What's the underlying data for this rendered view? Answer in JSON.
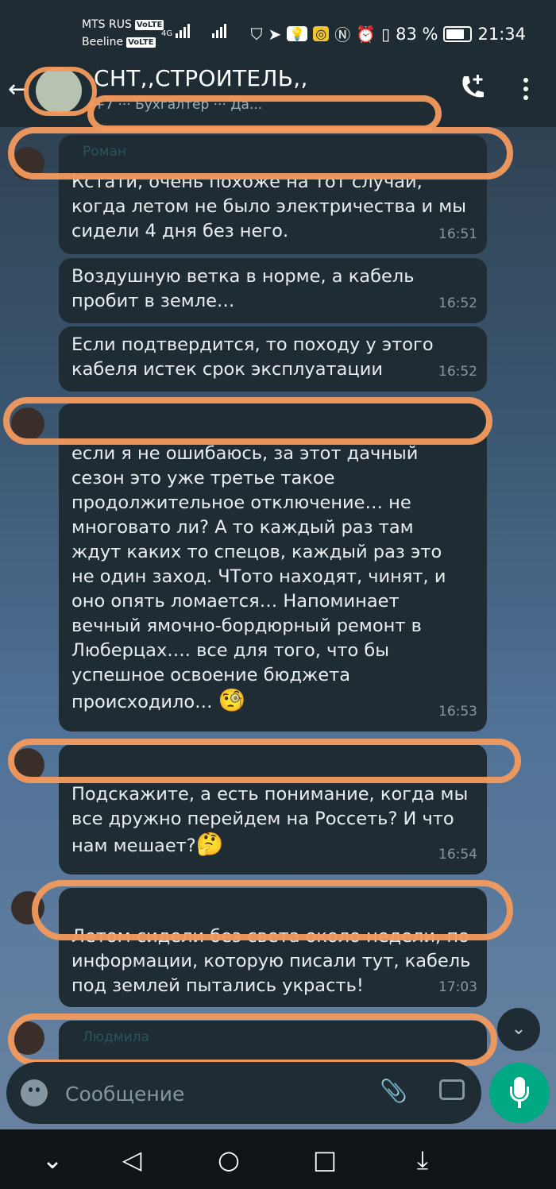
{
  "status_bar": {
    "carrier1": "MTS RUS",
    "carrier2": "Beeline",
    "volte": "VoLTE",
    "network": "4G",
    "battery": "83 %",
    "time": "21:34",
    "icons": [
      "signal-icon",
      "shield-icon",
      "telegram-icon",
      "bulb-icon",
      "target-icon",
      "nfc-icon",
      "alarm-icon",
      "vibrate-icon",
      "battery-icon"
    ]
  },
  "header": {
    "back_icon": "arrow-left-icon",
    "title": "СНТ,,СТРОИТЕЛЬ,,",
    "subtitle": "+7 ··· Бухгалтер ··· Да...",
    "call_icon": "add-call-icon",
    "menu_icon": "more-vert-icon"
  },
  "messages": [
    {
      "sender": "Роман",
      "text": "Кстати, очень похоже на тот случай, когда летом не было электричества и мы сидели 4 дня без него.",
      "time": "16:51"
    },
    {
      "sender": "",
      "text": "Воздушную ветка в норме, а кабель пробит в земле…",
      "time": "16:52"
    },
    {
      "sender": "",
      "text": "Если подтвердится, то походу у этого кабеля истек срок эксплуатации",
      "time": "16:52"
    },
    {
      "sender": "",
      "text": "если я не ошибаюсь, за этот дачный сезон это уже третье такое продолжительное отключение… не многовато ли? А то каждый раз там ждут каких то спецов, каждый раз это не один заход. ЧТото находят, чинят, и оно опять ломается… Напоминает вечный ямочно-бордюрный ремонт в Люберцах…. все для того, что бы успешное освоение бюджета происходило…",
      "emoji": "🧐",
      "time": "16:53"
    },
    {
      "sender": "",
      "text": "Подскажите, а есть понимание, когда мы все дружно перейдем на Россеть? И что нам мешает?",
      "emoji": "🤔",
      "time": "16:54"
    },
    {
      "sender": "",
      "text": "Летом сидели без света около недели, по информации, которую писали тут, кабель под землей пытались украсть!",
      "time": "17:03"
    },
    {
      "sender": "Людмила",
      "text": "",
      "time": ""
    }
  ],
  "composer": {
    "placeholder": "Сообщение",
    "emoji_icon": "emoji-icon",
    "attach_icon": "paperclip-icon",
    "camera_icon": "camera-icon",
    "mic_icon": "mic-icon",
    "scroll_icon": "double-chevron-down-icon"
  },
  "nav_bar": {
    "items": [
      "chevron-down-icon",
      "back-triangle-icon",
      "home-circle-icon",
      "recents-square-icon",
      "notification-pull-icon"
    ]
  }
}
